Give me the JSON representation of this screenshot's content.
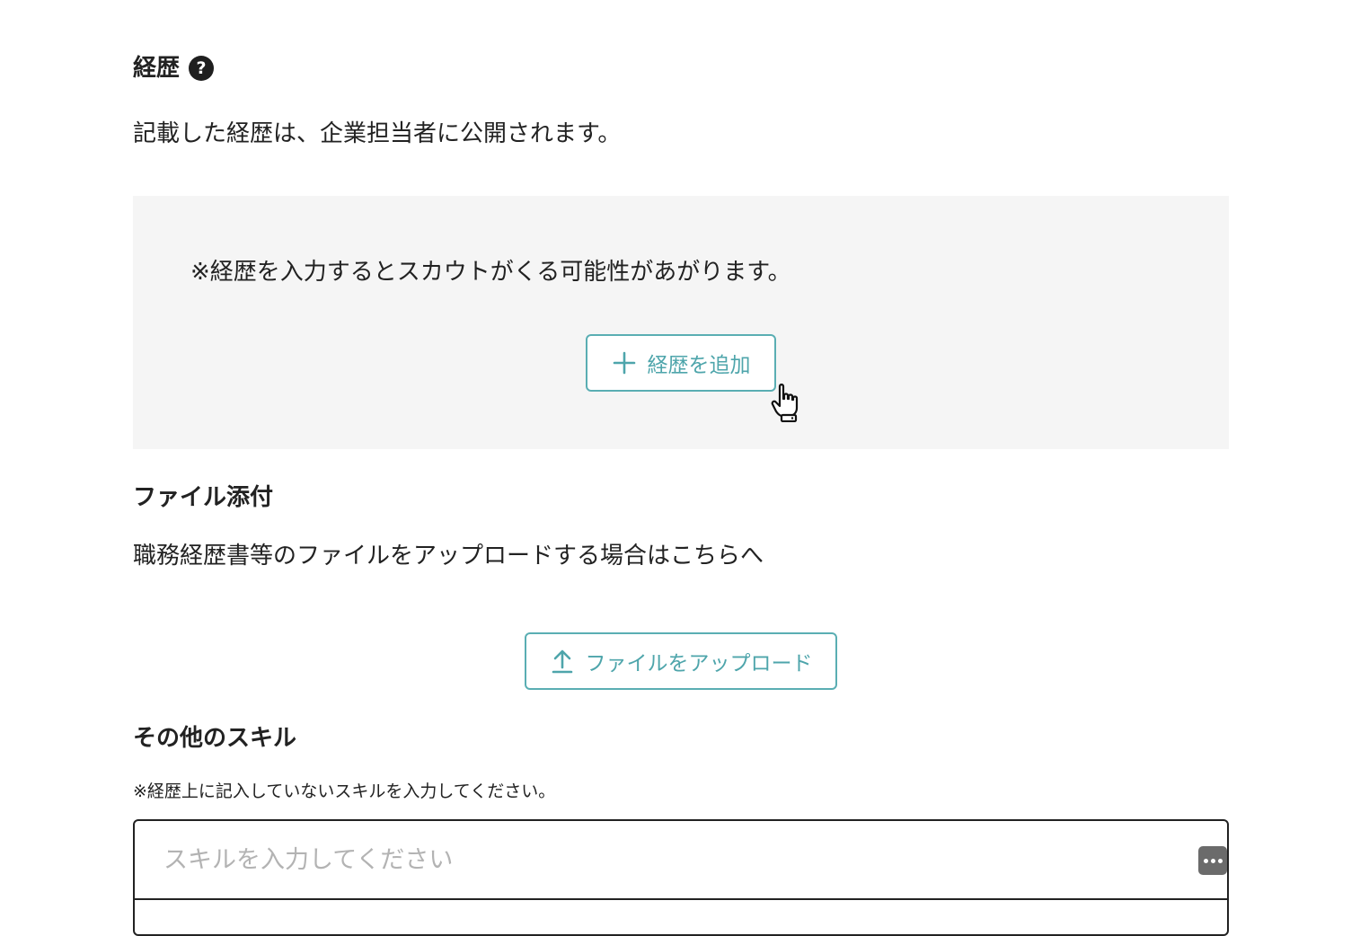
{
  "career": {
    "heading": "経歴",
    "help_icon_char": "?",
    "description": "記載した経歴は、企業担当者に公開されます。",
    "note": "※経歴を入力するとスカウトがくる可能性があがります。",
    "add_button_label": "経歴を追加"
  },
  "attachment": {
    "heading": "ファイル添付",
    "description": "職務経歴書等のファイルをアップロードする場合はこちらへ",
    "upload_button_label": "ファイルをアップロード"
  },
  "skills": {
    "heading": "その他のスキル",
    "note": "※経歴上に記入していないスキルを入力してください。",
    "input_placeholder": "スキルを入力してください",
    "input_value": ""
  },
  "colors": {
    "accent": "#5aaeb3",
    "box_background": "#f5f5f5",
    "text": "#222222",
    "placeholder": "#b3b3b3"
  },
  "icons": {
    "help": "question-circle-icon",
    "add": "plus-icon",
    "upload": "upload-arrow-icon",
    "cursor": "hand-pointer-icon",
    "password": "password-manager-icon"
  }
}
